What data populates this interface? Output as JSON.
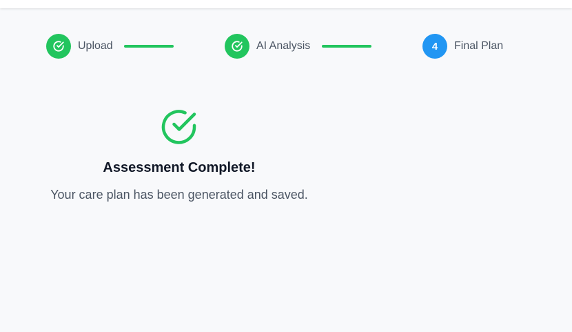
{
  "stepper": {
    "steps": [
      {
        "label": "Upload",
        "status": "complete",
        "icon": "check-circle-icon"
      },
      {
        "label": "AI Analysis",
        "status": "complete",
        "icon": "check-circle-icon"
      },
      {
        "label": "Final Plan",
        "status": "active",
        "number": "4"
      }
    ]
  },
  "result": {
    "icon": "check-circle-icon",
    "title": "Assessment Complete!",
    "message": "Your care plan has been generated and saved."
  },
  "colors": {
    "complete": "#22c55e",
    "active": "#2196f3",
    "background": "#f8f9fb"
  }
}
